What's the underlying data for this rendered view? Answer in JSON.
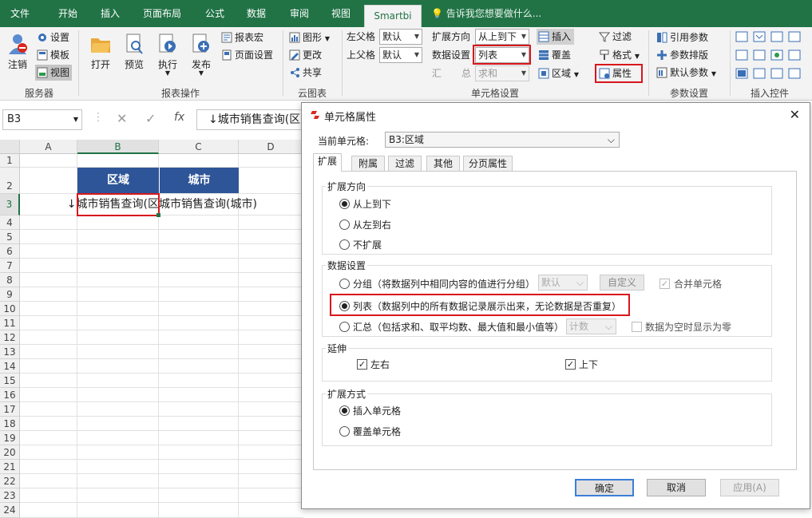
{
  "tabs": [
    "文件",
    "开始",
    "插入",
    "页面布局",
    "公式",
    "数据",
    "审阅",
    "视图",
    "Smartbi"
  ],
  "tell_me": "告诉我您想要做什么...",
  "ribbon": {
    "server": {
      "logout": "注销",
      "settings": "设置",
      "template": "模板",
      "view": "视图",
      "label": "服务器"
    },
    "report_ops": {
      "open": "打开",
      "preview": "预览",
      "execute": "执行",
      "publish": "发布",
      "macro": "报表宏",
      "page_setup": "页面设置",
      "label": "报表操作"
    },
    "cloud_chart": {
      "chart": "图形",
      "update": "更改",
      "share": "共享",
      "label": "云图表"
    },
    "cell_settings": {
      "left_parent": "左父格",
      "left_parent_val": "默认",
      "top_parent": "上父格",
      "top_parent_val": "默认",
      "expand_dir": "扩展方向",
      "expand_dir_val": "从上到下",
      "data_setting": "数据设置",
      "data_setting_val": "列表",
      "summary_a": "汇",
      "summary_b": "总",
      "summary_val": "求和",
      "insert": "插入",
      "cover": "覆盖",
      "area": "区域",
      "filter": "过滤",
      "format": "格式",
      "property": "属性",
      "label": "单元格设置"
    },
    "params": {
      "ref": "引用参数",
      "layout": "参数排版",
      "default": "默认参数",
      "label": "参数设置"
    },
    "controls": {
      "label": "插入控件"
    }
  },
  "name_box": "B3",
  "formula": "↓城市销售查询(区",
  "grid": {
    "columns": [
      "A",
      "B",
      "C",
      "D"
    ],
    "rows": [
      "1",
      "2",
      "3",
      "4",
      "5",
      "6",
      "7",
      "8",
      "9",
      "10",
      "11",
      "12",
      "13",
      "14",
      "15",
      "16",
      "17",
      "18",
      "19",
      "20",
      "21",
      "22",
      "23",
      "24"
    ],
    "header_b": "区域",
    "header_c": "城市",
    "b3": "↓城市销售查询(区",
    "c3": "城市销售查询(城市)"
  },
  "dialog": {
    "title": "单元格属性",
    "current_label": "当前单元格:",
    "current_value": "B3:区域",
    "tabs": [
      "扩展",
      "附属",
      "过滤",
      "其他",
      "分页属性"
    ],
    "expand_direction": {
      "title": "扩展方向",
      "options": [
        "从上到下",
        "从左到右",
        "不扩展"
      ]
    },
    "data_setting": {
      "title": "数据设置",
      "group": "分组（将数据列中相同内容的值进行分组）",
      "group_combo": "默认",
      "custom": "自定义",
      "merge": "合并单元格",
      "list": "列表（数据列中的所有数据记录展示出来，无论数据是否重复）",
      "summary": "汇总（包括求和、取平均数、最大值和最小值等）",
      "summary_combo": "计数",
      "zero": "数据为空时显示为零"
    },
    "extend": {
      "title": "延伸",
      "lr": "左右",
      "ud": "上下"
    },
    "expand_mode": {
      "title": "扩展方式",
      "insert": "插入单元格",
      "cover": "覆盖单元格"
    },
    "ok": "确定",
    "cancel": "取消",
    "apply": "应用(A)"
  }
}
